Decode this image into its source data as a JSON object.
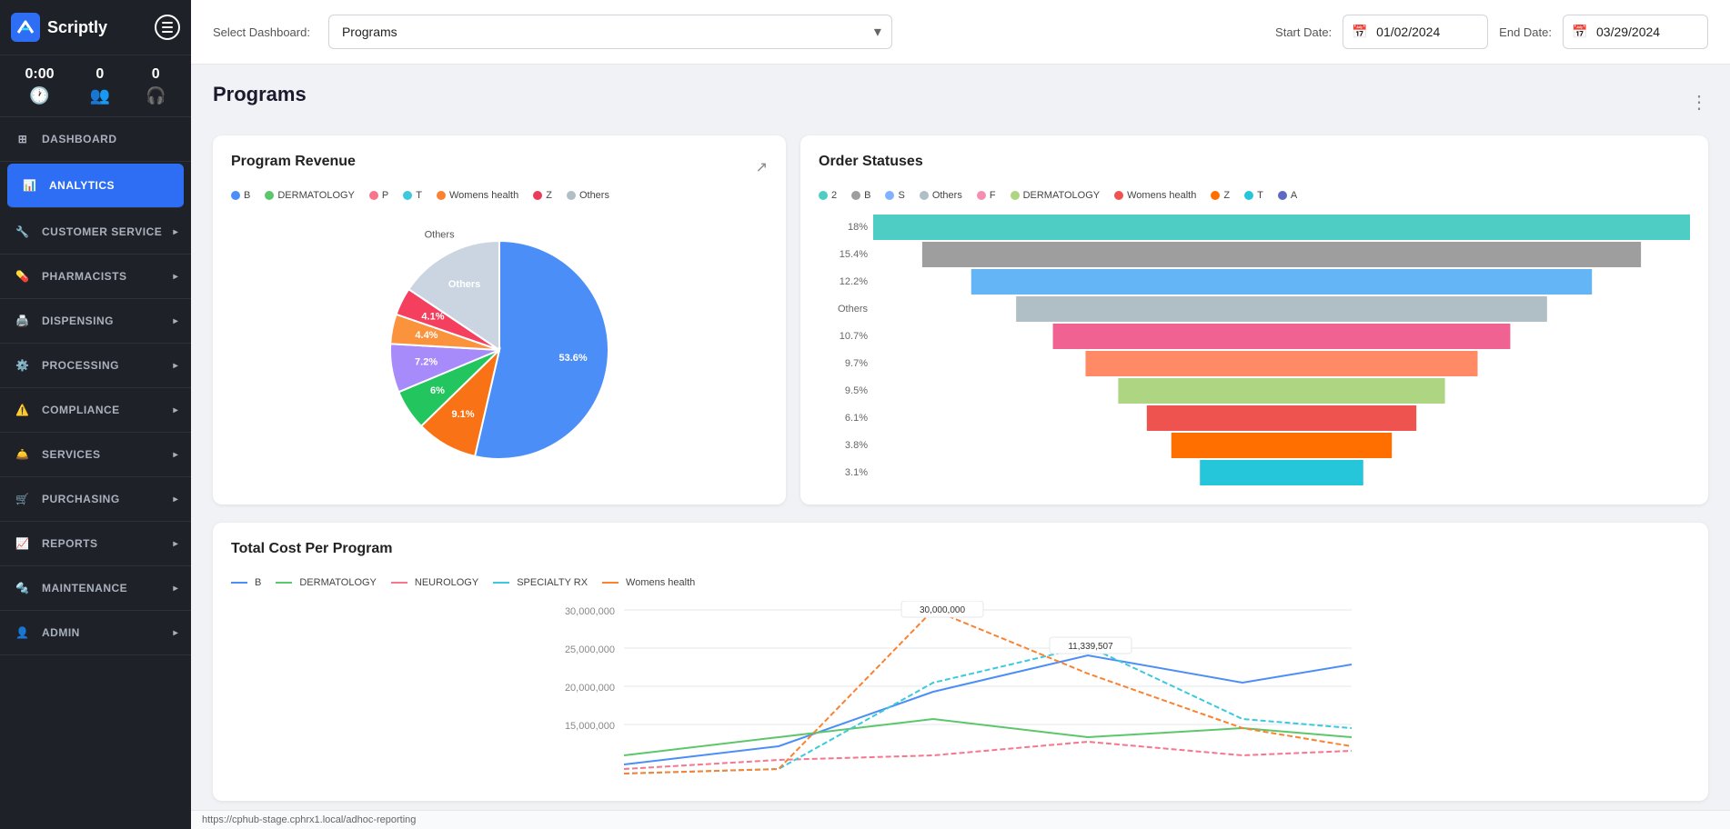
{
  "app": {
    "name": "Scriptly",
    "menu_icon": "☰"
  },
  "stats": [
    {
      "value": "0:00",
      "icon": "🕐"
    },
    {
      "value": "0",
      "icon": "👥"
    },
    {
      "value": "0",
      "icon": "🎧"
    }
  ],
  "nav": [
    {
      "id": "dashboard",
      "label": "DASHBOARD",
      "icon": "⊞",
      "active": false,
      "arrow": false
    },
    {
      "id": "analytics",
      "label": "ANALYTICS",
      "icon": "📊",
      "active": true,
      "arrow": false
    },
    {
      "id": "customer-service",
      "label": "CUSTOMER SERVICE",
      "icon": "🔧",
      "active": false,
      "arrow": true
    },
    {
      "id": "pharmacists",
      "label": "PHARMACISTS",
      "icon": "💊",
      "active": false,
      "arrow": true
    },
    {
      "id": "dispensing",
      "label": "DISPENSING",
      "icon": "🖨️",
      "active": false,
      "arrow": true
    },
    {
      "id": "processing",
      "label": "PROCESSING",
      "icon": "⚙️",
      "active": false,
      "arrow": true
    },
    {
      "id": "compliance",
      "label": "COMPLIANCE",
      "icon": "⚠️",
      "active": false,
      "arrow": true
    },
    {
      "id": "services",
      "label": "SERVICES",
      "icon": "🛎️",
      "active": false,
      "arrow": true
    },
    {
      "id": "purchasing",
      "label": "PURCHASING",
      "icon": "🛒",
      "active": false,
      "arrow": true
    },
    {
      "id": "reports",
      "label": "REPORTS",
      "icon": "📈",
      "active": false,
      "arrow": true
    },
    {
      "id": "maintenance",
      "label": "MAINTENANCE",
      "icon": "🔩",
      "active": false,
      "arrow": true
    },
    {
      "id": "admin",
      "label": "ADMIN",
      "icon": "👤",
      "active": false,
      "arrow": true
    }
  ],
  "topbar": {
    "select_label": "Select Dashboard:",
    "select_value": "Programs",
    "start_label": "Start Date:",
    "start_value": "01/02/2024",
    "end_label": "End Date:",
    "end_value": "03/29/2024"
  },
  "page_title": "Programs",
  "program_revenue": {
    "title": "Program Revenue",
    "legend": [
      {
        "label": "B",
        "color": "#4c8ef7"
      },
      {
        "label": "DERMATOLOGY",
        "color": "#5cc76a"
      },
      {
        "label": "P",
        "color": "#f7768e"
      },
      {
        "label": "T",
        "color": "#3bc9db"
      },
      {
        "label": "Womens health",
        "color": "#fa8231"
      },
      {
        "label": "Z",
        "color": "#eb3b5a"
      },
      {
        "label": "Others",
        "color": "#b0bec5"
      }
    ],
    "slices": [
      {
        "label": "53.6%",
        "color": "#4c8ef7",
        "percent": 53.6
      },
      {
        "label": "9.1%",
        "color": "#f97316",
        "percent": 9.1
      },
      {
        "label": "6%",
        "color": "#22c55e",
        "percent": 6
      },
      {
        "label": "7.2%",
        "color": "#a78bfa",
        "percent": 7.2
      },
      {
        "label": "4.4%",
        "color": "#fb923c",
        "percent": 4.4
      },
      {
        "label": "4.1%",
        "color": "#f43f5e",
        "percent": 4.1
      },
      {
        "label": "Others",
        "color": "#cbd5e1",
        "percent": 15.6
      }
    ]
  },
  "order_statuses": {
    "title": "Order Statuses",
    "legend": [
      {
        "label": "2",
        "color": "#4ecdc4"
      },
      {
        "label": "B",
        "color": "#9e9e9e"
      },
      {
        "label": "S",
        "color": "#82b1ff"
      },
      {
        "label": "Others",
        "color": "#b0bec5"
      },
      {
        "label": "F",
        "color": "#f48fb1"
      },
      {
        "label": "DERMATOLOGY",
        "color": "#aed581"
      },
      {
        "label": "Womens health",
        "color": "#ef5350"
      },
      {
        "label": "Z",
        "color": "#ff6f00"
      },
      {
        "label": "T",
        "color": "#26c6da"
      },
      {
        "label": "A",
        "color": "#5c6bc0"
      }
    ],
    "funnel_levels": [
      {
        "label": "18%",
        "color": "#4ecdc4",
        "width_pct": 100
      },
      {
        "label": "15.4%",
        "color": "#9e9e9e",
        "width_pct": 88
      },
      {
        "label": "12.2%",
        "color": "#64b5f6",
        "width_pct": 76
      },
      {
        "label": "Others",
        "color": "#b0bec5",
        "width_pct": 65
      },
      {
        "label": "10.7%",
        "color": "#f06292",
        "width_pct": 56
      },
      {
        "label": "9.7%",
        "color": "#ff8a65",
        "width_pct": 48
      },
      {
        "label": "9.5%",
        "color": "#aed581",
        "width_pct": 40
      },
      {
        "label": "6.1%",
        "color": "#ef5350",
        "width_pct": 33
      },
      {
        "label": "3.8%",
        "color": "#ff6f00",
        "width_pct": 27
      },
      {
        "label": "3.1%",
        "color": "#26c6da",
        "width_pct": 20
      }
    ]
  },
  "total_cost": {
    "title": "Total Cost Per Program",
    "legend": [
      {
        "label": "B",
        "color": "#4c8ef7"
      },
      {
        "label": "DERMATOLOGY",
        "color": "#5cc76a"
      },
      {
        "label": "NEUROLOGY",
        "color": "#f7768e"
      },
      {
        "label": "SPECIALTY RX",
        "color": "#3bc9db"
      },
      {
        "label": "Womens health",
        "color": "#fa8231"
      }
    ],
    "tooltip1": {
      "value": "30,000,000",
      "color": "#fa8231"
    },
    "tooltip2": {
      "value": "11,339,507",
      "color": "#3bc9db"
    },
    "y_labels": [
      "30,000,000",
      "25,000,000",
      "20,000,000",
      "15,000,000"
    ],
    "x_labels": [
      "",
      ""
    ]
  },
  "status_bar": {
    "url": "https://cphub-stage.cphrx1.local/adhoc-reporting"
  }
}
